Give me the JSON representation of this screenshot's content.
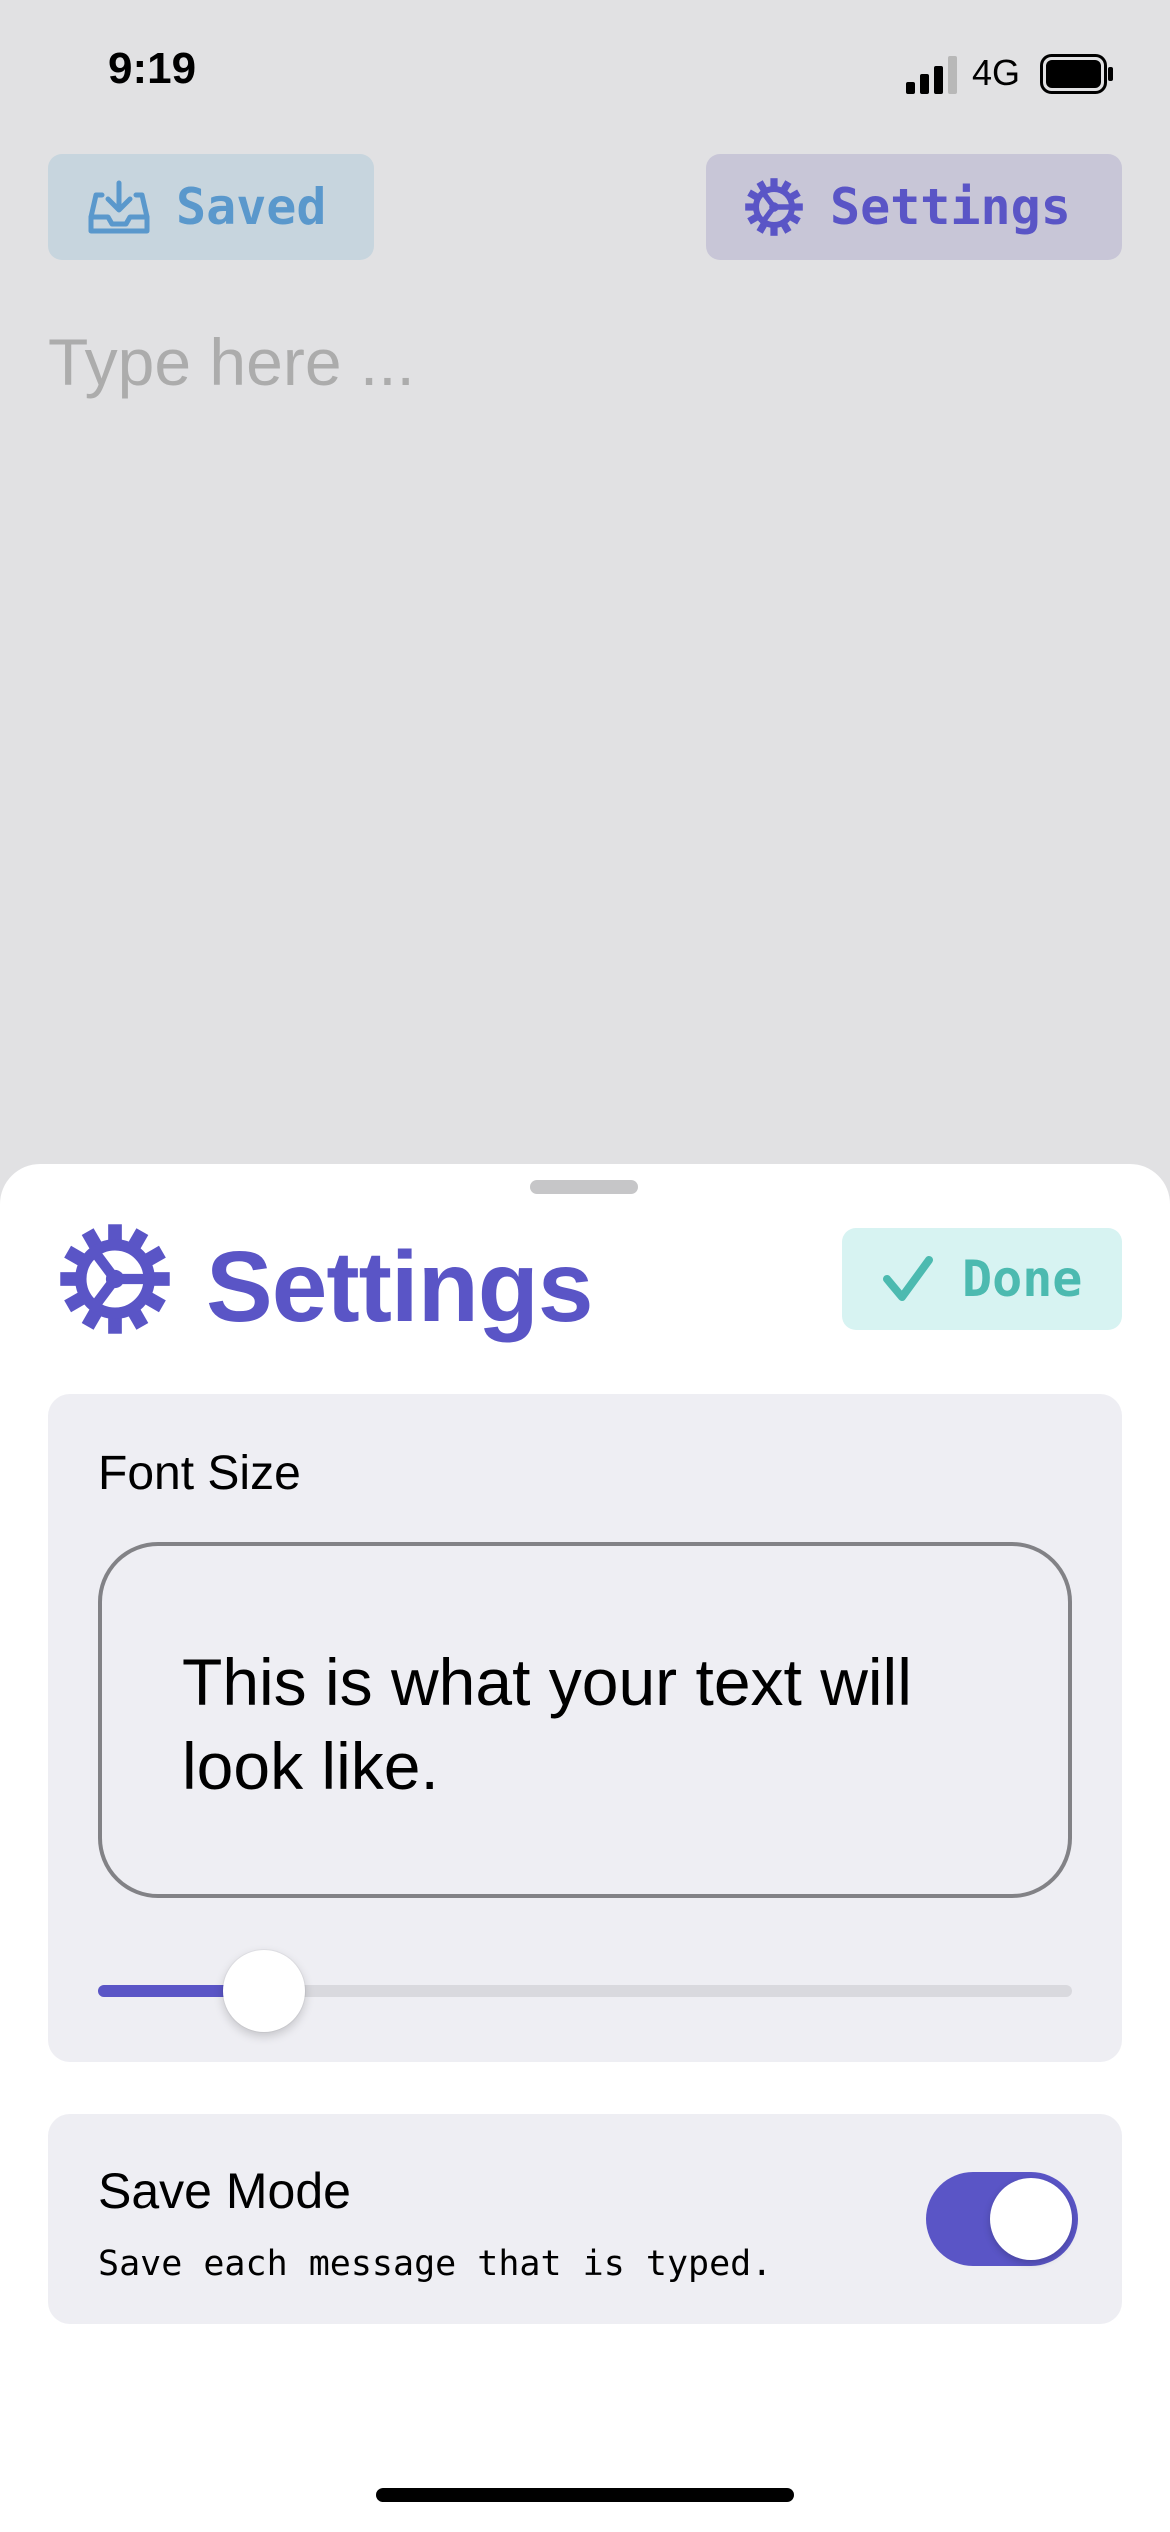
{
  "status_bar": {
    "time": "9:19",
    "network": "4G",
    "signal_icon": "signal-bars-icon",
    "battery_icon": "battery-icon"
  },
  "toolbar": {
    "saved_label": "Saved",
    "saved_icon": "inbox-download-icon",
    "settings_label": "Settings",
    "settings_icon": "gear-icon"
  },
  "editor": {
    "placeholder": "Type here ..."
  },
  "sheet": {
    "title": "Settings",
    "title_icon": "gear-icon",
    "done_label": "Done",
    "done_icon": "checkmark-icon",
    "font_size": {
      "label": "Font Size",
      "preview_text": "This is what your text will look like.",
      "slider_value": 0.17
    },
    "save_mode": {
      "label": "Save Mode",
      "description": "Save each message that is typed.",
      "enabled": true
    }
  },
  "colors": {
    "accent": "#5a55c6",
    "done_bg": "#d7f3f2",
    "done_text": "#4cbab0",
    "saved_bg": "#c7d5de",
    "saved_text": "#5a98cc",
    "card_bg": "#eeeef3",
    "dimmed_bg": "#e1e1e3"
  }
}
